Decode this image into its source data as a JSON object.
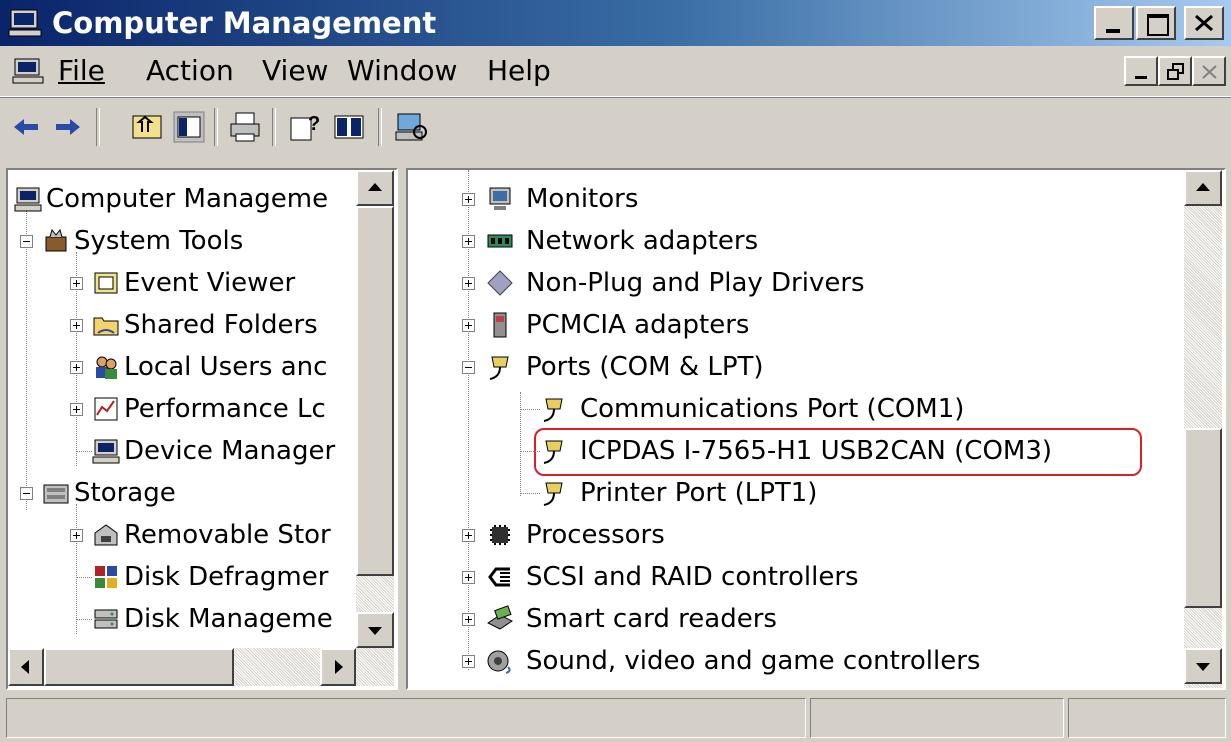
{
  "window": {
    "title": "Computer Management"
  },
  "menu": [
    {
      "id": "file",
      "label": "File"
    },
    {
      "id": "action",
      "label": "Action"
    },
    {
      "id": "view",
      "label": "View"
    },
    {
      "id": "window",
      "label": "Window"
    },
    {
      "id": "help",
      "label": "Help"
    }
  ],
  "left_tree": [
    {
      "label": "Computer Manageme",
      "icon": "computer-icon"
    },
    {
      "label": "System Tools",
      "icon": "toolbox-icon"
    },
    {
      "label": "Event Viewer",
      "icon": "event-viewer-icon"
    },
    {
      "label": "Shared Folders",
      "icon": "shared-folders-icon"
    },
    {
      "label": "Local Users anc",
      "icon": "users-icon"
    },
    {
      "label": "Performance Lc",
      "icon": "performance-icon"
    },
    {
      "label": "Device Manager",
      "icon": "device-manager-icon"
    },
    {
      "label": "Storage",
      "icon": "storage-icon"
    },
    {
      "label": "Removable Stor",
      "icon": "removable-storage-icon"
    },
    {
      "label": "Disk Defragmer",
      "icon": "defrag-icon"
    },
    {
      "label": "Disk Manageme",
      "icon": "disk-management-icon"
    }
  ],
  "device_tree": [
    {
      "label": "Monitors",
      "icon": "monitor-icon"
    },
    {
      "label": "Network adapters",
      "icon": "network-adapter-icon"
    },
    {
      "label": "Non-Plug and Play Drivers",
      "icon": "driver-icon"
    },
    {
      "label": "PCMCIA adapters",
      "icon": "pcmcia-icon"
    },
    {
      "label": "Ports (COM & LPT)",
      "icon": "port-icon"
    },
    {
      "label": "Communications Port (COM1)",
      "icon": "port-icon"
    },
    {
      "label": "ICPDAS I-7565-H1 USB2CAN (COM3)",
      "icon": "port-icon"
    },
    {
      "label": "Printer Port (LPT1)",
      "icon": "port-icon"
    },
    {
      "label": "Processors",
      "icon": "processor-icon"
    },
    {
      "label": "SCSI and RAID controllers",
      "icon": "scsi-icon"
    },
    {
      "label": "Smart card readers",
      "icon": "smart-card-icon"
    },
    {
      "label": "Sound, video and game controllers",
      "icon": "sound-icon"
    }
  ],
  "colors": {
    "title_start": "#0a246a",
    "title_end": "#a6caf0",
    "highlight": "#d8202a",
    "chrome": "#d4d0c8"
  }
}
